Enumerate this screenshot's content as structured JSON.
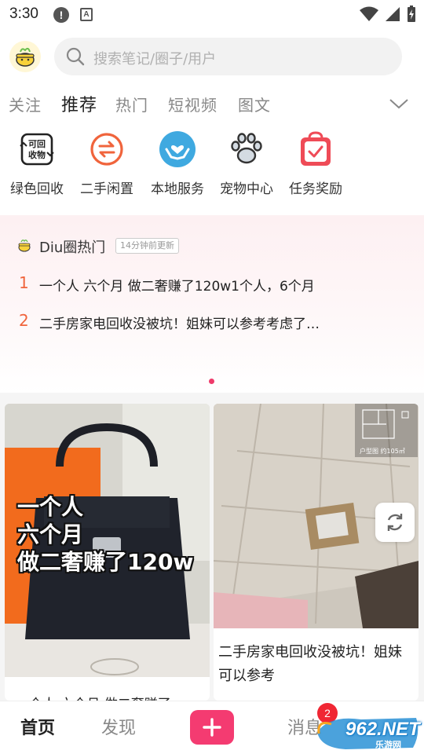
{
  "status_bar": {
    "time": "3:30",
    "alert_glyph": "!",
    "a_glyph": "A"
  },
  "search": {
    "placeholder": "搜索笔记/圈子/用户"
  },
  "tabs": [
    {
      "label": "关注",
      "active": false
    },
    {
      "label": "推荐",
      "active": true
    },
    {
      "label": "热门",
      "active": false
    },
    {
      "label": "短视频",
      "active": false
    },
    {
      "label": "图文",
      "active": false
    }
  ],
  "entries": [
    {
      "label": "绿色回收",
      "icon": "recycle-box-icon",
      "icon_text": [
        "可回",
        "收物"
      ]
    },
    {
      "label": "二手闲置",
      "icon": "exchange-icon"
    },
    {
      "label": "本地服务",
      "icon": "heart-hands-icon"
    },
    {
      "label": "宠物中心",
      "icon": "paw-icon"
    },
    {
      "label": "任务奖励",
      "icon": "task-bag-icon"
    }
  ],
  "hot": {
    "title": "Diu圈热门",
    "badge": "14分钟前更新",
    "items": [
      {
        "rank": "1",
        "text": "一个人 六个月 做二奢赚了120w1个人，6个月"
      },
      {
        "rank": "2",
        "text": "二手房家电回收没被坑！姐妹可以参考考虑了…"
      }
    ]
  },
  "feed": {
    "left": {
      "overlay_lines": [
        "一个人",
        "六个月",
        "做二奢赚了120w"
      ],
      "title": "一个人 六个月 做二奢赚了"
    },
    "right": {
      "floorplan_label": "户型图 约105㎡",
      "title": "二手房家电回收没被坑！姐妹可以参考"
    }
  },
  "bottom_nav": {
    "home": "首页",
    "discover": "发现",
    "messages": "消息",
    "messages_badge": "2"
  },
  "watermark": {
    "text": "962.NET",
    "sub": "乐游网"
  },
  "colors": {
    "accent": "#f43b71",
    "rank": "#f0643c",
    "badge": "#f02633",
    "blue_icon": "#3fa9e0",
    "orange_icon": "#f0643c",
    "red_icon": "#ef4b57"
  }
}
